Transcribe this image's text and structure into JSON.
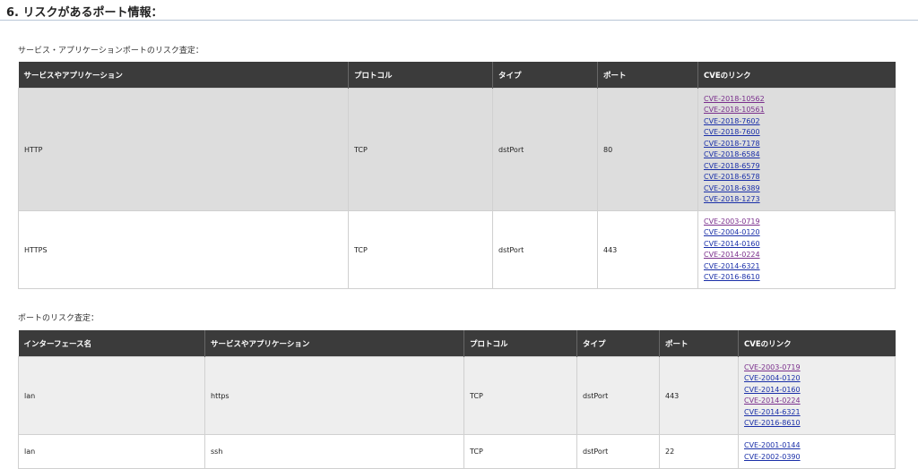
{
  "section": {
    "title": "6. リスクがあるポート情報："
  },
  "table1": {
    "caption": "サービス・アプリケーションポートのリスク査定：",
    "headers": [
      "サービスやアプリケーション",
      "プロトコル",
      "タイプ",
      "ポート",
      "CVEのリンク"
    ],
    "rows": [
      {
        "service": "HTTP",
        "protocol": "TCP",
        "type": "dstPort",
        "port": "80",
        "cves": [
          "CVE-2018-10562",
          "CVE-2018-10561",
          "CVE-2018-7602",
          "CVE-2018-7600",
          "CVE-2018-7178",
          "CVE-2018-6584",
          "CVE-2018-6579",
          "CVE-2018-6578",
          "CVE-2018-6389",
          "CVE-2018-1273"
        ]
      },
      {
        "service": "HTTPS",
        "protocol": "TCP",
        "type": "dstPort",
        "port": "443",
        "cves": [
          "CVE-2003-0719",
          "CVE-2004-0120",
          "CVE-2014-0160",
          "CVE-2014-0224",
          "CVE-2014-6321",
          "CVE-2016-8610"
        ]
      }
    ]
  },
  "table2": {
    "caption": "ポートのリスク査定：",
    "headers": [
      "インターフェース名",
      "サービスやアプリケーション",
      "プロトコル",
      "タイプ",
      "ポート",
      "CVEのリンク"
    ],
    "rows": [
      {
        "interface": "lan",
        "service": "https",
        "protocol": "TCP",
        "type": "dstPort",
        "port": "443",
        "cves": [
          "CVE-2003-0719",
          "CVE-2004-0120",
          "CVE-2014-0160",
          "CVE-2014-0224",
          "CVE-2014-6321",
          "CVE-2016-8610"
        ]
      },
      {
        "interface": "lan",
        "service": "ssh",
        "protocol": "TCP",
        "type": "dstPort",
        "port": "22",
        "cves": [
          "CVE-2001-0144",
          "CVE-2002-0390"
        ]
      }
    ]
  },
  "colors": {
    "header_bg": "#3b3b3b",
    "link": "#1a2fa8",
    "link_visited": "#7a2f8c",
    "row_shade": "#dddddd"
  }
}
